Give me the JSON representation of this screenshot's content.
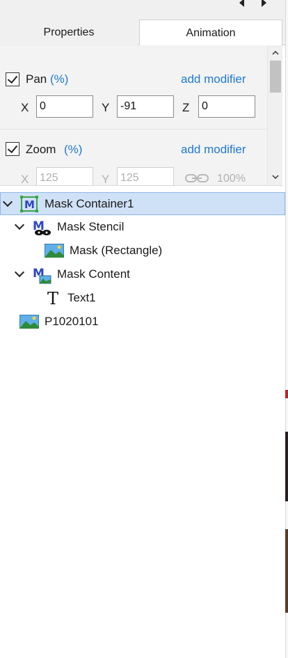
{
  "tabs": {
    "properties": "Properties",
    "animation": "Animation",
    "active": "Animation"
  },
  "pan": {
    "title": "Pan",
    "unit": "(%)",
    "checked": true,
    "add_modifier": "add modifier",
    "x_label": "X",
    "x_value": "0",
    "y_label": "Y",
    "y_value": "-91",
    "z_label": "Z",
    "z_value": "0"
  },
  "zoom": {
    "title": "Zoom",
    "unit": "(%)",
    "checked": true,
    "add_modifier": "add modifier",
    "x_label": "X",
    "x_value": "125",
    "y_label": "Y",
    "y_value": "125",
    "percent": "100%"
  },
  "tree": {
    "items": [
      {
        "label": "Mask Container1",
        "icon": "mask-container-icon",
        "selected": true,
        "expanded": true
      },
      {
        "label": "Mask Stencil",
        "icon": "mask-stencil-icon",
        "expanded": true
      },
      {
        "label": "Mask (Rectangle)",
        "icon": "image-icon"
      },
      {
        "label": "Mask Content",
        "icon": "mask-content-icon",
        "expanded": true
      },
      {
        "label": "Text1",
        "icon": "text-icon"
      },
      {
        "label": "P1020101",
        "icon": "image-icon"
      }
    ]
  },
  "colors": {
    "accent": "#1f7ad1",
    "selection": "#cfe1f7",
    "panel_bg": "#f3f3f3"
  }
}
